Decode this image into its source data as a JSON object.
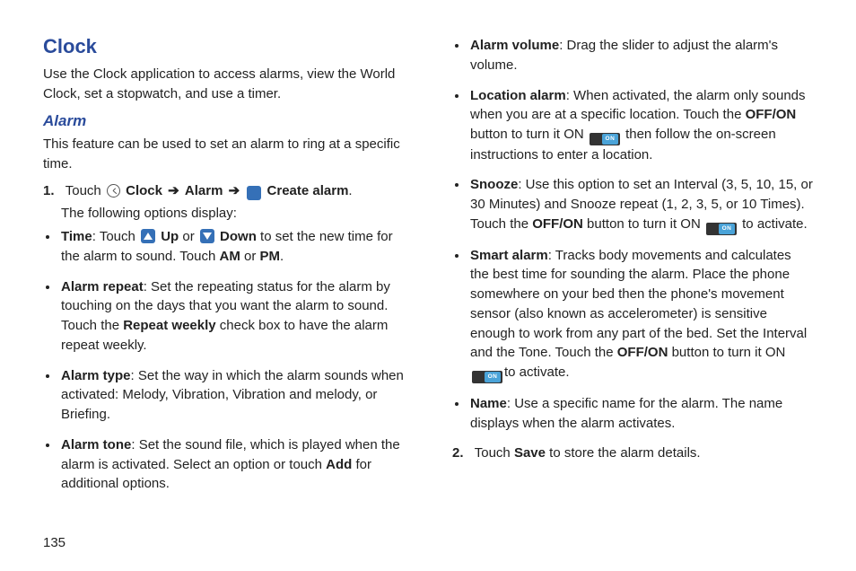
{
  "chart_data": null,
  "page_number": "135",
  "section": {
    "title": "Clock",
    "intro": "Use the Clock application to access alarms, view the World Clock, set a stopwatch, and use a timer.",
    "sub1": {
      "title": "Alarm",
      "intro": "This feature can be used to set an alarm to ring at a specific time.",
      "step1": {
        "num": "1.",
        "prefix": "Touch ",
        "clock_label": "Clock",
        "arrow": "➔",
        "alarm_label": "Alarm",
        "create_label": "Create alarm",
        "period": ".",
        "after": "The following options display:",
        "bullets": [
          {
            "label": "Time",
            "t_touch": ": Touch ",
            "up": "Up",
            "t_or": " or ",
            "down": "Down",
            "t_rest1": " to set the new time for the alarm to sound. Touch ",
            "am": "AM",
            "t_or2": " or ",
            "pm": "PM",
            "t_dot": "."
          },
          {
            "label": "Alarm repeat",
            "body_a": ": Set the repeating status for the alarm by touching on the days that you want the alarm to sound. Touch the ",
            "rw": "Repeat weekly",
            "body_b": " check box to have the alarm repeat weekly."
          },
          {
            "label": "Alarm type",
            "body": ": Set the way in which the alarm sounds when activated: Melody, Vibration, Vibration and melody, or Briefing."
          },
          {
            "label": "Alarm tone",
            "body_a": ": Set the sound file, which is played when the alarm is activated. Select an option or touch ",
            "add": "Add",
            "body_b": " for additional options."
          }
        ]
      },
      "col2": {
        "bullets": [
          {
            "label": "Alarm volume",
            "body": ": Drag the slider to adjust the alarm's volume."
          },
          {
            "label": "Location alarm",
            "body_a": ": When activated, the alarm only sounds when you are at a specific location. Touch the ",
            "offon": "OFF/ON",
            "body_b": " button to turn it ON ",
            "toggle": "ON",
            "body_c": " then follow the on-screen instructions to enter a location."
          },
          {
            "label": "Snooze",
            "body_a": ": Use this option to set an Interval (3, 5, 10, 15, or 30 Minutes) and Snooze repeat (1, 2, 3, 5, or 10 Times). Touch the ",
            "offon": "OFF/ON",
            "body_b": " button to turn it ON ",
            "toggle": "ON",
            "body_c": " to activate."
          },
          {
            "label": "Smart alarm",
            "body_a": ": Tracks body movements and calculates the best time for sounding the alarm. Place the phone somewhere on your bed then the phone's movement sensor  (also known as accelerometer) is sensitive enough to work from any part of the bed. Set the Interval and the Tone. Touch the ",
            "offon": "OFF/ON",
            "body_b": " button to turn it ON ",
            "toggle": "ON",
            "body_c": "to activate."
          },
          {
            "label": "Name",
            "body": ": Use a specific name for the alarm. The name displays when the alarm activates."
          }
        ],
        "step2": {
          "num": "2.",
          "t_a": "Touch ",
          "save": "Save",
          "t_b": " to store the alarm details."
        }
      }
    }
  }
}
